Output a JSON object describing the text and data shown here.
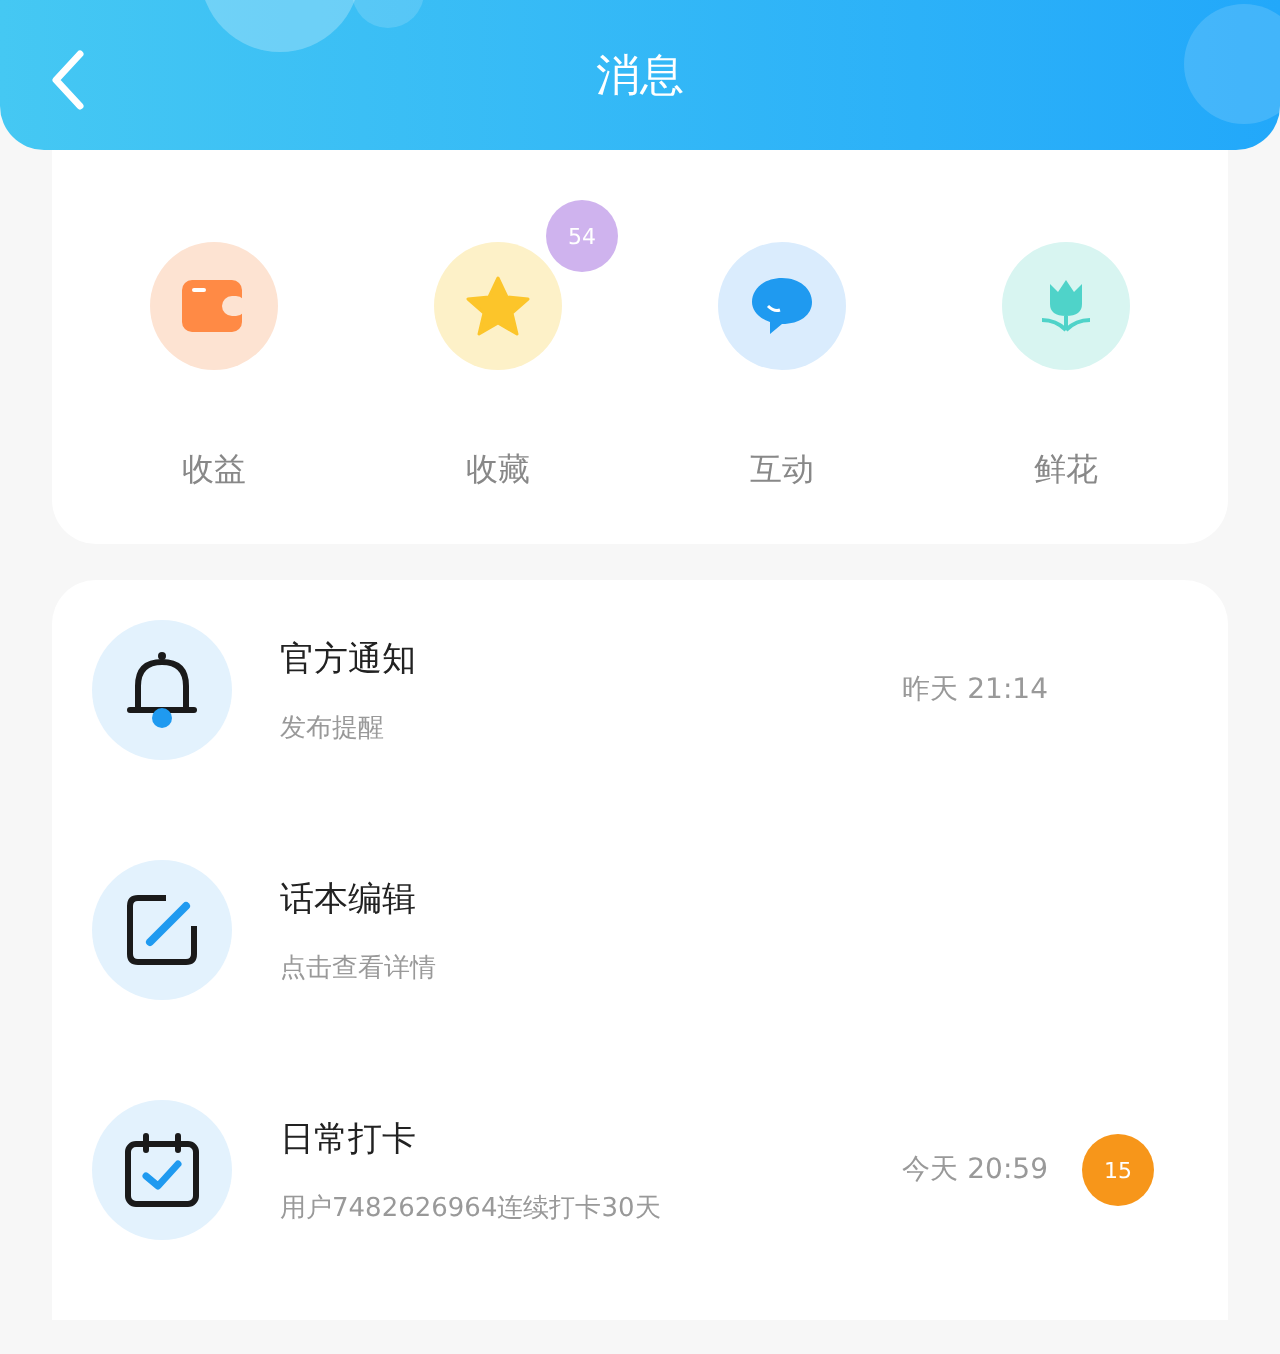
{
  "header": {
    "title": "消息"
  },
  "shortcuts": [
    {
      "label": "收益"
    },
    {
      "label": "收藏",
      "badge": "54"
    },
    {
      "label": "互动"
    },
    {
      "label": "鲜花"
    }
  ],
  "messages": [
    {
      "title": "官方通知",
      "subtitle": "发布提醒",
      "time": "昨天 21:14"
    },
    {
      "title": "话本编辑",
      "subtitle": "点击查看详情"
    },
    {
      "title": "日常打卡",
      "subtitle": "用户7482626964连续打卡30天",
      "time": "今天 20:59",
      "badge": "15"
    }
  ]
}
